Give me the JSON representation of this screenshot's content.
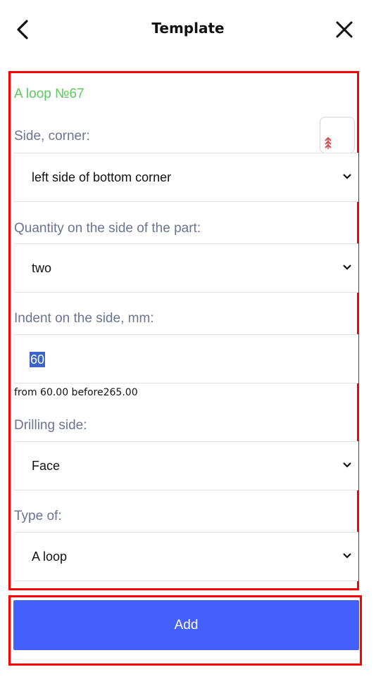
{
  "header": {
    "title": "Template",
    "back_icon": "chevron-left-icon",
    "close_icon": "close-icon"
  },
  "form": {
    "title": "A loop №67",
    "title_color": "#5cc95c",
    "preview_icon": "arrows-up-icon",
    "side_corner": {
      "label": "Side, corner:",
      "value": "left side of bottom corner"
    },
    "quantity": {
      "label": "Quantity on the side of the part:",
      "value": "two"
    },
    "indent": {
      "label": "Indent on the side, mm:",
      "value": "60",
      "hint": "from 60.00 before265.00"
    },
    "drilling_side": {
      "label": "Drilling side:",
      "value": "Face"
    },
    "type": {
      "label": "Type of:",
      "value": "A loop"
    }
  },
  "actions": {
    "add_label": "Add",
    "add_color": "#4460fb"
  },
  "colors": {
    "highlight_border": "#ff0000",
    "label_color": "#6b7490",
    "selection": "#3b64c8"
  }
}
